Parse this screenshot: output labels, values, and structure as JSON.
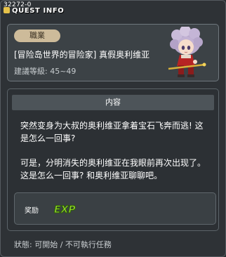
{
  "window": {
    "id_label": "32272-0",
    "title": "QUEST INFO"
  },
  "quest": {
    "job_label": "職業",
    "name": "[冒险岛世界的冒险家] 真假奥利维亚",
    "level_req": "建議等級: 45~49"
  },
  "content": {
    "header": "内容",
    "paragraph1": "突然变身为大叔的奥利维亚拿着宝石飞奔而逃! 这是怎么一回事?",
    "paragraph2": "可是，分明消失的奥利维亚在我眼前再次出现了。这是怎么一回事? 和奥利维亚聊聊吧。"
  },
  "reward": {
    "label": "奖励",
    "exp_text": "EXP"
  },
  "status": "狀態: 可開始 / 不可執行任務",
  "colors": {
    "exp_green": "#8fd42a",
    "badge": "#cdbb9a"
  }
}
